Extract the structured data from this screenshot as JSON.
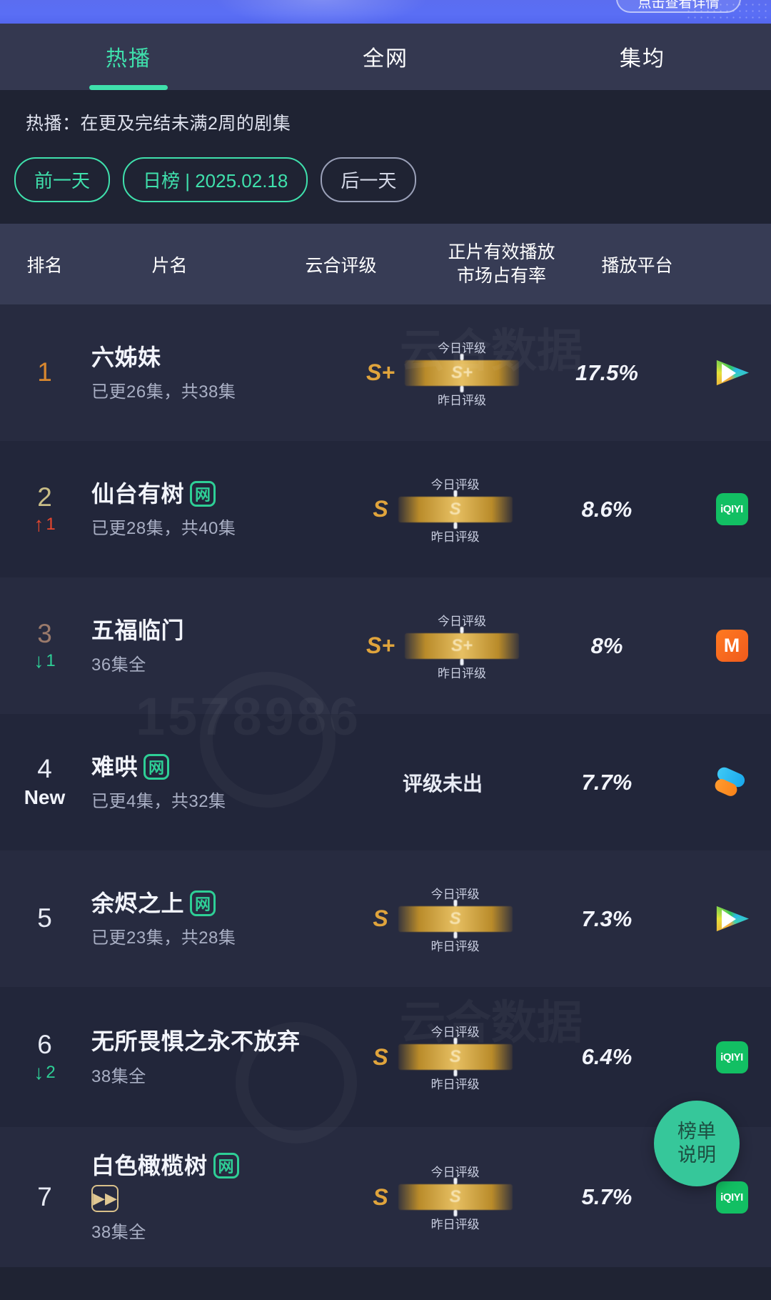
{
  "topbar": {
    "pill_label": "点击查看详情"
  },
  "tabs": [
    {
      "label": "热播",
      "active": true
    },
    {
      "label": "全网",
      "active": false
    },
    {
      "label": "集均",
      "active": false
    }
  ],
  "subtitle": "热播：在更及完结未满2周的剧集",
  "date_controls": {
    "prev_label": "前一天",
    "current_label": "日榜 | 2025.02.18",
    "next_label": "后一天"
  },
  "table_headers": {
    "rank": "排名",
    "title": "片名",
    "rating": "云合评级",
    "share_line1": "正片有效播放",
    "share_line2": "市场占有率",
    "platform": "播放平台"
  },
  "rating_caption": {
    "today": "今日评级",
    "yesterday": "昨日评级"
  },
  "rating_pending_label": "评级未出",
  "badges": {
    "net": "网",
    "fastforward": "▶▶",
    "new": "New"
  },
  "fab": {
    "line1": "榜单",
    "line2": "说明"
  },
  "watermarks": {
    "w1": "云合数据",
    "w2": "1578986",
    "w3": "云合数据"
  },
  "colors": {
    "accent": "#3fe0ac",
    "rank1": "#d8872f",
    "rank2": "#c9bd86",
    "rank3": "#9b7a6b",
    "up": "#e8472e",
    "down": "#2ecf96",
    "rating_gold": "#e7c063",
    "background": "#1f2333",
    "header_bg": "#373c55"
  },
  "rows": [
    {
      "rank": "1",
      "move": "",
      "move_dir": "none",
      "is_new": false,
      "title": "六姊妹",
      "net_badge": false,
      "ff_badge": false,
      "episodes": "已更26集，共38集",
      "rating_letter": "S+",
      "rating_bar": "S+",
      "rating_pending": false,
      "share": "17.5%",
      "platform": "tencent-video"
    },
    {
      "rank": "2",
      "move": "1",
      "move_dir": "up",
      "is_new": false,
      "title": "仙台有树",
      "net_badge": true,
      "ff_badge": false,
      "episodes": "已更28集，共40集",
      "rating_letter": "S",
      "rating_bar": "S",
      "rating_pending": false,
      "share": "8.6%",
      "platform": "iqiyi"
    },
    {
      "rank": "3",
      "move": "1",
      "move_dir": "down",
      "is_new": false,
      "title": "五福临门",
      "net_badge": false,
      "ff_badge": false,
      "episodes": "36集全",
      "rating_letter": "S+",
      "rating_bar": "S+",
      "rating_pending": false,
      "share": "8%",
      "platform": "mango-tv"
    },
    {
      "rank": "4",
      "move": "",
      "move_dir": "none",
      "is_new": true,
      "title": "难哄",
      "net_badge": true,
      "ff_badge": false,
      "episodes": "已更4集，共32集",
      "rating_letter": "",
      "rating_bar": "",
      "rating_pending": true,
      "share": "7.7%",
      "platform": "youku"
    },
    {
      "rank": "5",
      "move": "",
      "move_dir": "none",
      "is_new": false,
      "title": "余烬之上",
      "net_badge": true,
      "ff_badge": false,
      "episodes": "已更23集，共28集",
      "rating_letter": "S",
      "rating_bar": "S",
      "rating_pending": false,
      "share": "7.3%",
      "platform": "tencent-video"
    },
    {
      "rank": "6",
      "move": "2",
      "move_dir": "down",
      "is_new": false,
      "title": "无所畏惧之永不放弃",
      "net_badge": false,
      "ff_badge": false,
      "episodes": "38集全",
      "rating_letter": "S",
      "rating_bar": "S",
      "rating_pending": false,
      "share": "6.4%",
      "platform": "iqiyi"
    },
    {
      "rank": "7",
      "move": "",
      "move_dir": "none",
      "is_new": false,
      "title": "白色橄榄树",
      "net_badge": true,
      "ff_badge": true,
      "episodes": "38集全",
      "rating_letter": "S",
      "rating_bar": "S",
      "rating_pending": false,
      "share": "5.7%",
      "platform": "iqiyi"
    }
  ]
}
